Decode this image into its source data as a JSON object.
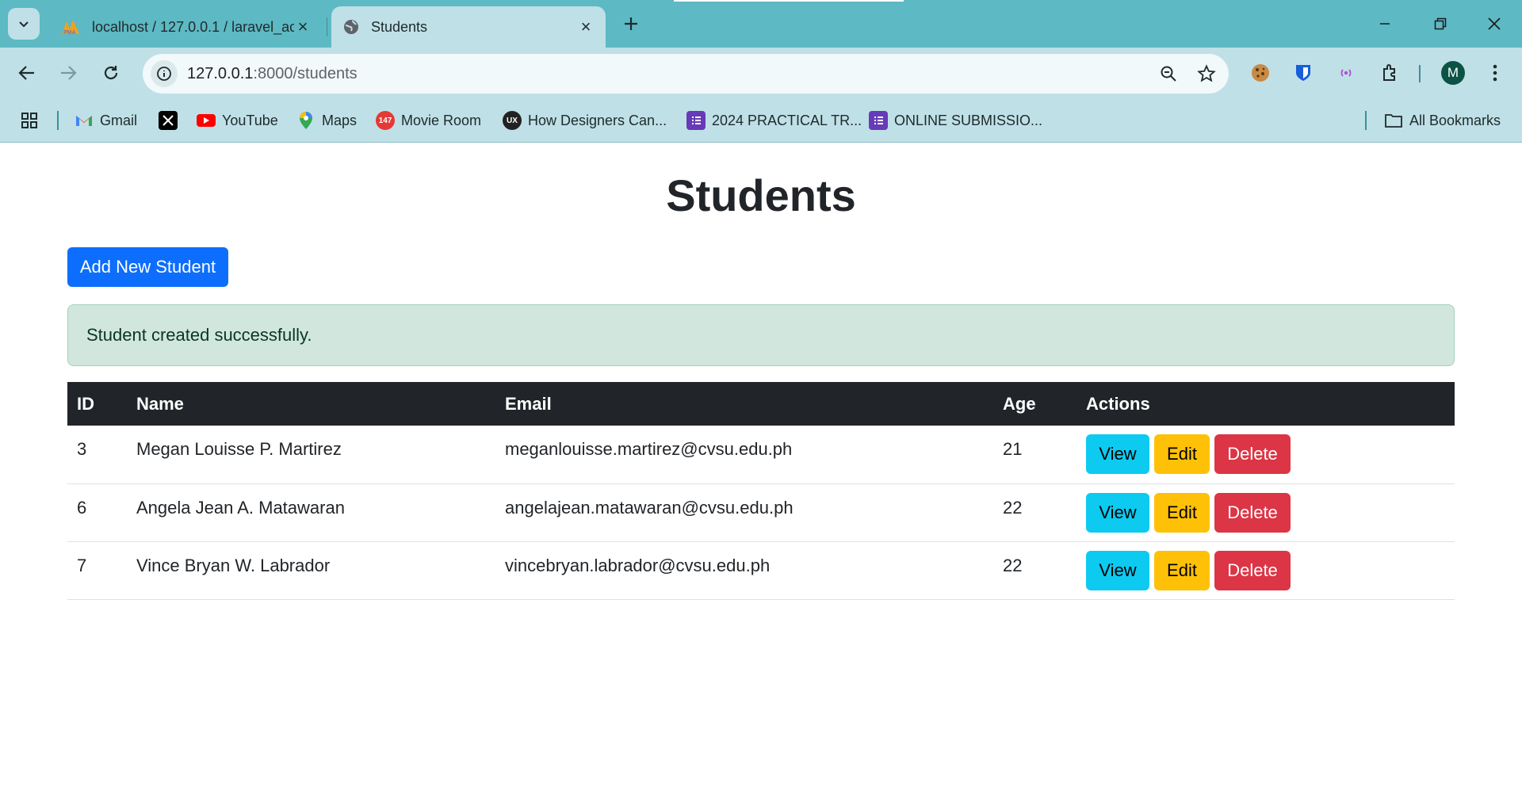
{
  "browser": {
    "tabs": [
      {
        "title": "localhost / 127.0.0.1 / laravel_ac",
        "favicon": "phpmyadmin-icon",
        "active": false
      },
      {
        "title": "Students",
        "favicon": "globe-icon",
        "active": true
      }
    ],
    "url_host": "127.0.0.1",
    "url_path": ":8000/students",
    "avatar_letter": "M",
    "bookmarks": [
      {
        "label": "Gmail",
        "icon": "gmail-icon"
      },
      {
        "label": "",
        "icon": "x-icon"
      },
      {
        "label": "YouTube",
        "icon": "youtube-icon"
      },
      {
        "label": "Maps",
        "icon": "maps-icon"
      },
      {
        "label": "Movie Room",
        "icon": "movie-room-icon"
      },
      {
        "label": "How Designers Can...",
        "icon": "ux-icon"
      },
      {
        "label": "2024 PRACTICAL TR...",
        "icon": "forms-icon"
      },
      {
        "label": "ONLINE SUBMISSIO...",
        "icon": "forms-icon"
      }
    ],
    "all_bookmarks": "All Bookmarks"
  },
  "page": {
    "title": "Students",
    "add_button": "Add New Student",
    "alert": "Student created successfully.",
    "table": {
      "headers": {
        "id": "ID",
        "name": "Name",
        "email": "Email",
        "age": "Age",
        "actions": "Actions"
      },
      "rows": [
        {
          "id": "3",
          "name": "Megan Louisse P. Martirez",
          "email": "meganlouisse.martirez@cvsu.edu.ph",
          "age": "21"
        },
        {
          "id": "6",
          "name": "Angela Jean A. Matawaran",
          "email": "angelajean.matawaran@cvsu.edu.ph",
          "age": "22"
        },
        {
          "id": "7",
          "name": "Vince Bryan W. Labrador",
          "email": "vincebryan.labrador@cvsu.edu.ph",
          "age": "22"
        }
      ],
      "actions": {
        "view": "View",
        "edit": "Edit",
        "delete": "Delete"
      }
    }
  },
  "colors": {
    "primary": "#0d6efd",
    "info": "#0dcaf0",
    "warning": "#ffc107",
    "danger": "#dc3545",
    "success_bg": "#d1e7dd",
    "chrome_frame": "#5db9c3",
    "chrome_toolbar": "#bfe0e6"
  }
}
